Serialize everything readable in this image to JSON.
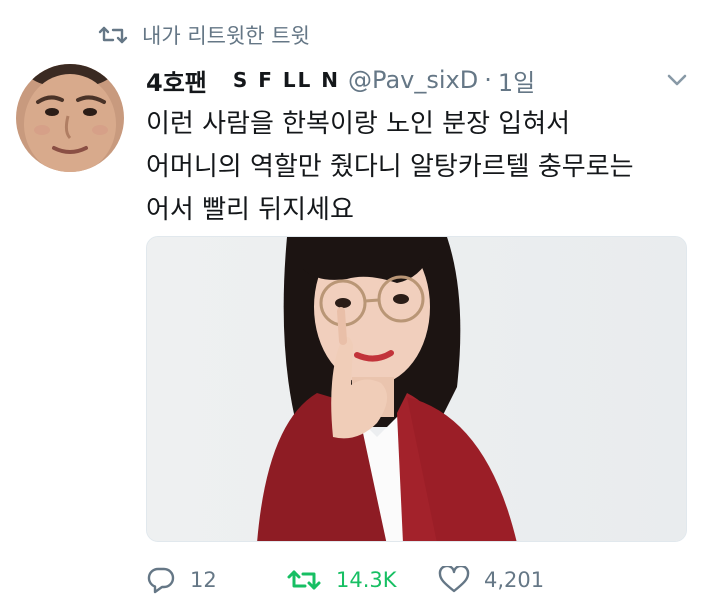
{
  "retweet_context": {
    "text": "내가 리트윗한 트윗",
    "icon": "retweet-icon"
  },
  "tweet": {
    "display_name": "4호팬",
    "name_decoration": "S F LL N",
    "handle": "@Pav_sixD",
    "separator": "·",
    "time": "1일",
    "text_lines": [
      "이런 사람을 한복이랑 노인 분장 입혀서",
      "어머니의 역할만 줬다니 알탕카르텔 충무로는",
      "어서 빨리 뒤지세요"
    ]
  },
  "actions": {
    "reply_count": "12",
    "retweet_count": "14.3K",
    "like_count": "4,201"
  },
  "colors": {
    "text": "#14171a",
    "secondary": "#657786",
    "retweet_active": "#17bf63"
  }
}
